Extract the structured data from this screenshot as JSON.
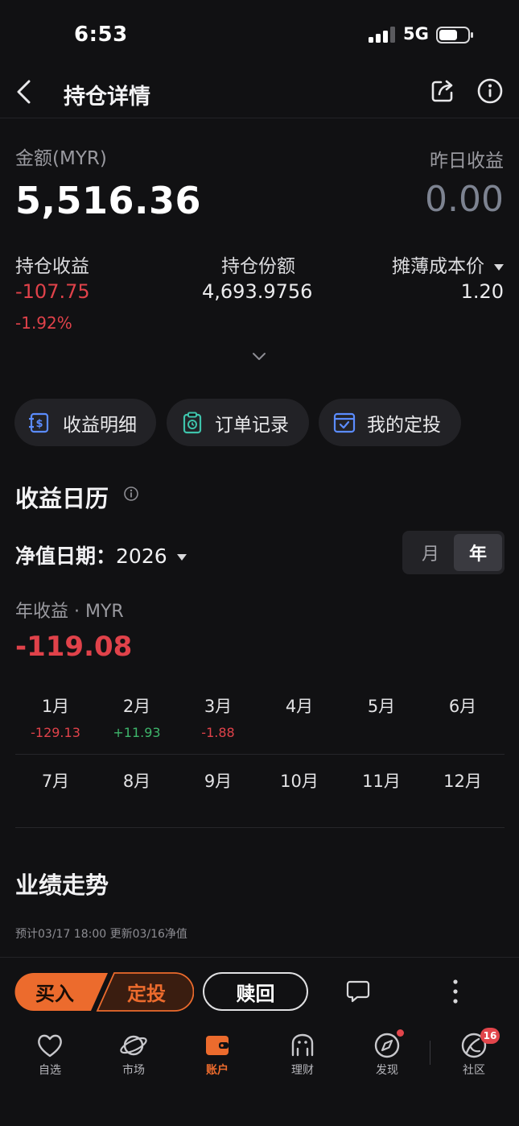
{
  "status_bar": {
    "time": "6:53",
    "network": "5G"
  },
  "header": {
    "title": "持仓详情"
  },
  "summary": {
    "amount_label": "金额(MYR)",
    "amount": "5,516.36",
    "yesterday_label": "昨日收益",
    "yesterday_value": "0.00",
    "holding_profit_label": "持仓收益",
    "holding_profit": "-107.75",
    "holding_profit_pct": "-1.92%",
    "holding_share_label": "持仓份额",
    "holding_share": "4,693.9756",
    "cost_label": "摊薄成本价",
    "cost_value": "1.20"
  },
  "pills": [
    {
      "label": "收益明细",
      "icon": "dollar-doc-icon"
    },
    {
      "label": "订单记录",
      "icon": "clipboard-icon"
    },
    {
      "label": "我的定投",
      "icon": "calendar-check-icon"
    }
  ],
  "calendar": {
    "title": "收益日历",
    "date_label": "净值日期：",
    "date_value": "2026",
    "seg_month": "月",
    "seg_year": "年",
    "year_label": "年收益 · MYR",
    "year_value": "-119.08",
    "months": [
      {
        "name": "1月",
        "value": "-129.13",
        "tone": "red"
      },
      {
        "name": "2月",
        "value": "+11.93",
        "tone": "green"
      },
      {
        "name": "3月",
        "value": "-1.88",
        "tone": "red"
      },
      {
        "name": "4月",
        "value": ""
      },
      {
        "name": "5月",
        "value": ""
      },
      {
        "name": "6月",
        "value": ""
      },
      {
        "name": "7月",
        "value": ""
      },
      {
        "name": "8月",
        "value": ""
      },
      {
        "name": "9月",
        "value": ""
      },
      {
        "name": "10月",
        "value": ""
      },
      {
        "name": "11月",
        "value": ""
      },
      {
        "name": "12月",
        "value": ""
      }
    ]
  },
  "performance": {
    "title": "业绩走势",
    "note": "预计03/17 18:00 更新03/16净值"
  },
  "actions": {
    "buy": "买入",
    "plan": "定投",
    "redeem": "赎回"
  },
  "tabs": [
    {
      "label": "自选",
      "icon": "heart-icon"
    },
    {
      "label": "市场",
      "icon": "planet-icon"
    },
    {
      "label": "账户",
      "icon": "wallet-icon"
    },
    {
      "label": "理财",
      "icon": "piggy-icon"
    },
    {
      "label": "发现",
      "icon": "compass-icon"
    },
    {
      "label": "社区",
      "icon": "community-icon",
      "badge": "16"
    }
  ],
  "colors": {
    "accent": "#ec6b2d",
    "loss": "#e0424a",
    "gain": "#3eb56b",
    "background": "#111113"
  }
}
